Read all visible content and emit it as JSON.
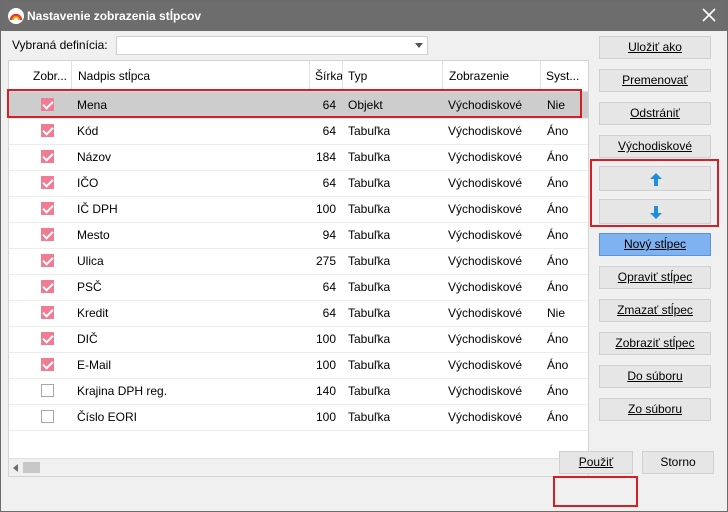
{
  "window": {
    "title": "Nastavenie zobrazenia stĺpcov",
    "title_bar_color": "#6d6d6d"
  },
  "definition": {
    "label": "Vybraná definícia:",
    "value": ""
  },
  "grid": {
    "headers": [
      "Zobr...",
      "Nadpis stĺpca",
      "Šírka",
      "Typ",
      "Zobrazenie",
      "Syst..."
    ],
    "rows": [
      {
        "visible": true,
        "name": "Mena",
        "width": "64",
        "type": "Objekt",
        "display": "Východiskové",
        "system": "Nie"
      },
      {
        "visible": true,
        "name": "Kód",
        "width": "64",
        "type": "Tabuľka",
        "display": "Východiskové",
        "system": "Áno"
      },
      {
        "visible": true,
        "name": "Názov",
        "width": "184",
        "type": "Tabuľka",
        "display": "Východiskové",
        "system": "Áno"
      },
      {
        "visible": true,
        "name": "IČO",
        "width": "64",
        "type": "Tabuľka",
        "display": "Východiskové",
        "system": "Áno"
      },
      {
        "visible": true,
        "name": "IČ DPH",
        "width": "100",
        "type": "Tabuľka",
        "display": "Východiskové",
        "system": "Áno"
      },
      {
        "visible": true,
        "name": "Mesto",
        "width": "94",
        "type": "Tabuľka",
        "display": "Východiskové",
        "system": "Áno"
      },
      {
        "visible": true,
        "name": "Ulica",
        "width": "275",
        "type": "Tabuľka",
        "display": "Východiskové",
        "system": "Áno"
      },
      {
        "visible": true,
        "name": "PSČ",
        "width": "64",
        "type": "Tabuľka",
        "display": "Východiskové",
        "system": "Áno"
      },
      {
        "visible": true,
        "name": "Kredit",
        "width": "64",
        "type": "Tabuľka",
        "display": "Východiskové",
        "system": "Nie"
      },
      {
        "visible": true,
        "name": "DIČ",
        "width": "100",
        "type": "Tabuľka",
        "display": "Východiskové",
        "system": "Áno"
      },
      {
        "visible": true,
        "name": "E-Mail",
        "width": "100",
        "type": "Tabuľka",
        "display": "Východiskové",
        "system": "Áno"
      },
      {
        "visible": false,
        "name": "Krajina DPH reg.",
        "width": "140",
        "type": "Tabuľka",
        "display": "Východiskové",
        "system": "Áno"
      },
      {
        "visible": false,
        "name": "Číslo EORI",
        "width": "100",
        "type": "Tabuľka",
        "display": "Východiskové",
        "system": "Áno"
      }
    ],
    "selected_row": 0,
    "checkbox_color": "#f07c93"
  },
  "buttons": {
    "save_as": "Uložiť ako",
    "rename": "Premenovať",
    "delete": "Odstrániť",
    "default": "Východiskové",
    "move_up_icon": "arrow-up-icon",
    "move_down_icon": "arrow-down-icon",
    "new_column": "Nový stĺpec",
    "edit_column": "Opraviť stĺpec",
    "delete_column": "Zmazať stĺpec",
    "show_column": "Zobraziť stĺpec",
    "to_file": "Do súboru",
    "from_file": "Zo súboru",
    "apply": "Použiť",
    "cancel": "Storno"
  },
  "colors": {
    "highlight": "#d81e25",
    "primary_button": "#7fb2f0",
    "arrow_icon": "#1f8fdc"
  }
}
